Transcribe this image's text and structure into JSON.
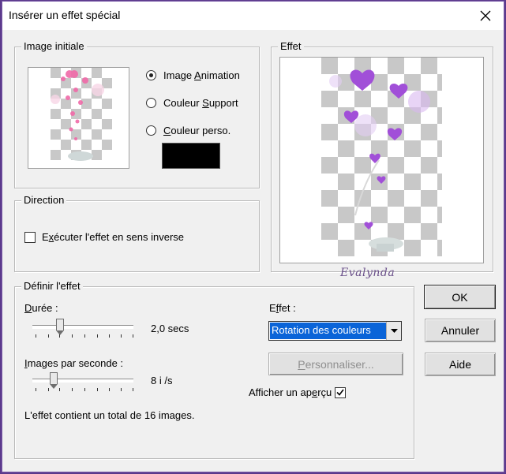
{
  "window": {
    "title": "Insérer un effet spécial"
  },
  "image_initiale": {
    "legend": "Image initiale",
    "options": [
      {
        "prefix": "Image ",
        "key": "A",
        "suffix": "nimation",
        "selected": true
      },
      {
        "prefix": "Couleur ",
        "key": "S",
        "suffix": "upport",
        "selected": false
      },
      {
        "prefix": "",
        "key": "C",
        "suffix": "ouleur perso.",
        "selected": false
      }
    ],
    "custom_color": "#000000"
  },
  "direction": {
    "legend": "Direction",
    "reverse": {
      "prefix": "E",
      "key": "x",
      "suffix": "écuter l'effet en sens inverse",
      "checked": false
    }
  },
  "effet_preview": {
    "legend": "Effet",
    "watermark": "Evalynda"
  },
  "definir": {
    "legend": "Définir l'effet",
    "duree": {
      "key": "D",
      "suffix": "urée :",
      "value": "2,0 secs",
      "level": 0.2
    },
    "ips": {
      "key": "I",
      "suffix": "mages par seconde :",
      "value": "8 i /s",
      "level": 0.15
    },
    "total": "L'effet contient un total de 16 images.",
    "effet_label": {
      "prefix": "E",
      "key": "f",
      "suffix": "fet :"
    },
    "effet_value": "Rotation des couleurs",
    "personnaliser": {
      "prefix": "",
      "key": "P",
      "suffix": "ersonnaliser..."
    },
    "apercu": {
      "prefix": "Afficher un ap",
      "key": "e",
      "suffix": "rçu",
      "checked": true
    }
  },
  "buttons": {
    "ok": "OK",
    "annuler": "Annuler",
    "aide": "Aide"
  }
}
